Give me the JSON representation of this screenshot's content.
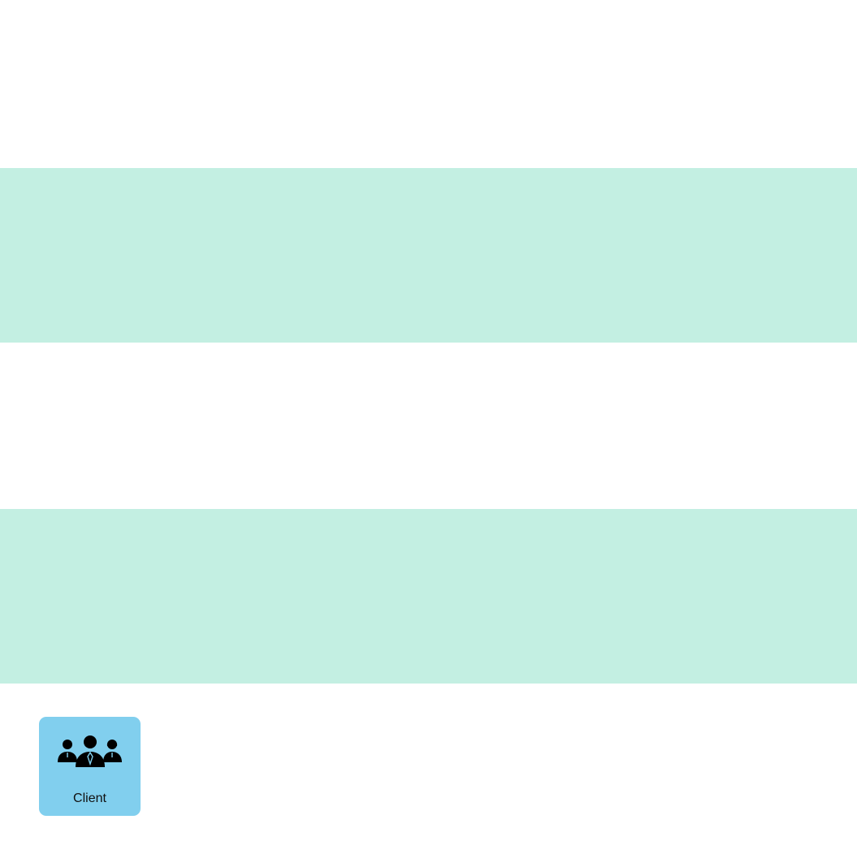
{
  "colors": {
    "page_background": "#ffffff",
    "band": "#c3efe2",
    "card_background": "#81cfee",
    "icon": "#000000",
    "label": "#111111"
  },
  "lanes": [
    {
      "label": ""
    },
    {
      "label": ""
    }
  ],
  "client_node": {
    "label": "Client",
    "icon": "users-group-icon"
  }
}
